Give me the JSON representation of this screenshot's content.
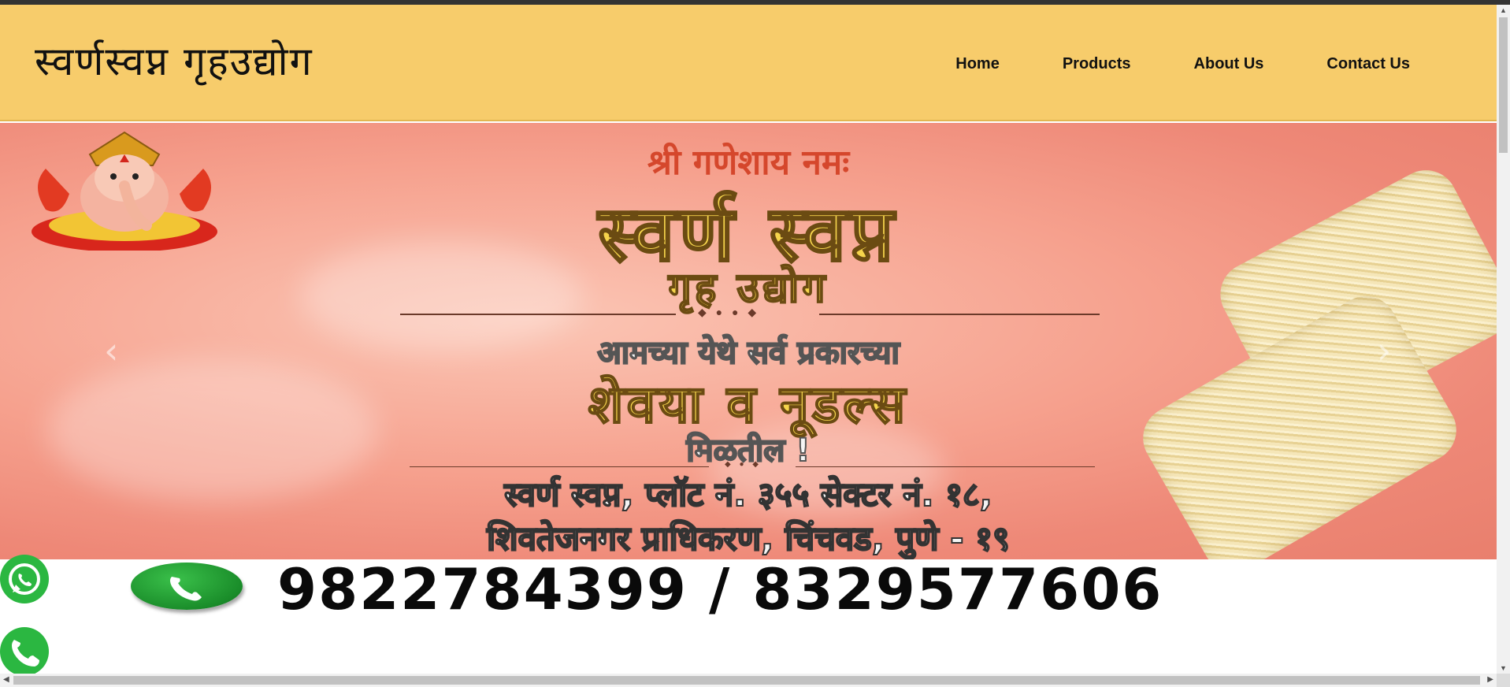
{
  "header": {
    "brand": "स्वर्णस्वप्न  गृहउद्योग",
    "nav": [
      "Home",
      "Products",
      "About Us",
      "Contact Us"
    ]
  },
  "banner": {
    "line1": "श्री गणेशाय नमः",
    "line2": "स्वर्ण स्वप्न",
    "line3": "गृह उद्योग",
    "line4": "आमच्या येथे सर्व प्रकारच्या",
    "line5": "शेवया व नूडल्स",
    "line6": "मिळतील !",
    "line7": "स्वर्ण स्वप्न, प्लॉट नं. ३५५ सेक्टर नं. १८,",
    "line8": "शिवतेजनगर प्राधिकरण, चिंचवड, पुणे - १९",
    "phones": "9822784399 / 8329577606",
    "prev_arrow": "‹",
    "next_arrow": "›"
  },
  "floating": {
    "whatsapp_icon": "whatsapp-icon",
    "call_icon": "phone-icon"
  },
  "colors": {
    "navbar": "#f7cc6b",
    "banner": "#f6a18e",
    "float_button": "#2bb741"
  }
}
